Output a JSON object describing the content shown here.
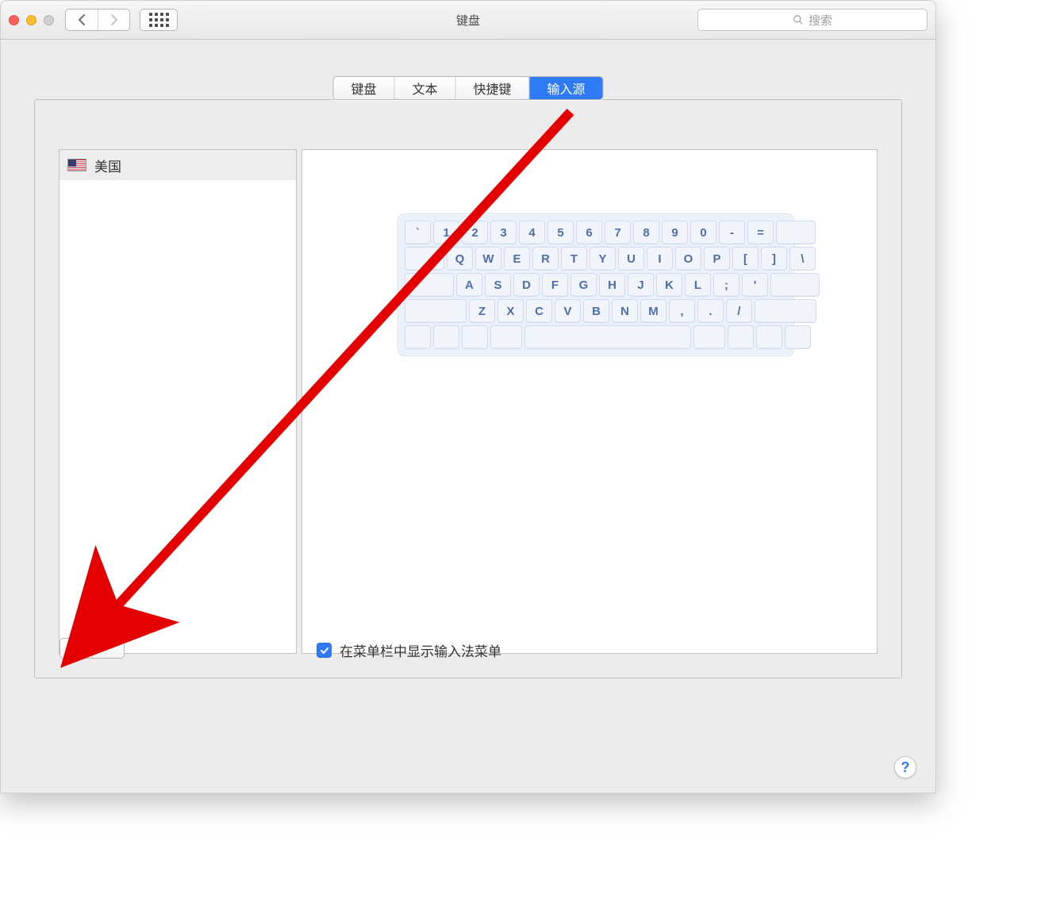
{
  "window": {
    "title": "键盘"
  },
  "search": {
    "placeholder": "搜索"
  },
  "tabs": {
    "keyboard": "键盘",
    "text": "文本",
    "shortcuts": "快捷键",
    "input_sources": "输入源"
  },
  "sources": {
    "items": [
      {
        "label": "美国",
        "flag": "us"
      }
    ]
  },
  "keyboard_preview": {
    "row1": [
      "`",
      "1",
      "2",
      "3",
      "4",
      "5",
      "6",
      "7",
      "8",
      "9",
      "0",
      "-",
      "="
    ],
    "row2": [
      "Q",
      "W",
      "E",
      "R",
      "T",
      "Y",
      "U",
      "I",
      "O",
      "P",
      "[",
      "]",
      "\\"
    ],
    "row3": [
      "A",
      "S",
      "D",
      "F",
      "G",
      "H",
      "J",
      "K",
      "L",
      ";",
      "'"
    ],
    "row4": [
      "Z",
      "X",
      "C",
      "V",
      "B",
      "N",
      "M",
      ",",
      ".",
      "/"
    ]
  },
  "controls": {
    "add": "+",
    "remove": "−"
  },
  "checkbox": {
    "show_in_menubar": "在菜单栏中显示输入法菜单",
    "checked": true
  },
  "help": "?"
}
